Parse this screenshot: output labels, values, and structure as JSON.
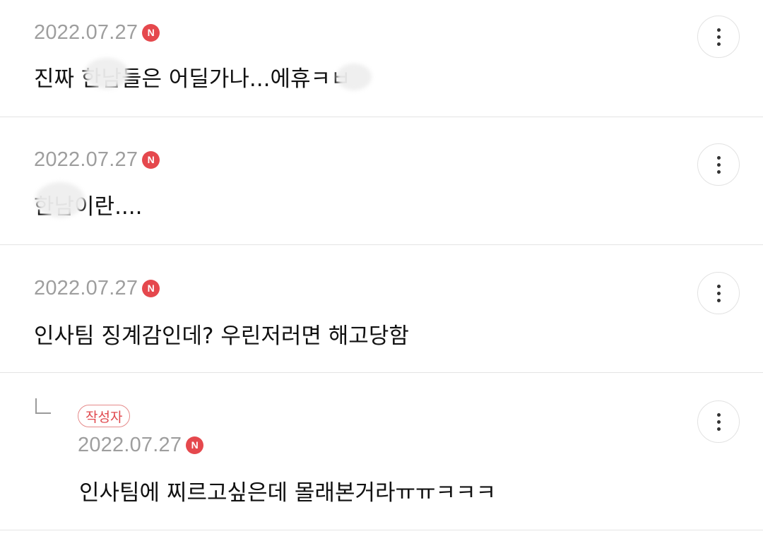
{
  "comments": [
    {
      "date": "2022.07.27",
      "new_badge": "N",
      "text": "진짜 한남들은 어딜가나...에휴ㅋㅂ"
    },
    {
      "date": "2022.07.27",
      "new_badge": "N",
      "text": "한남이란...."
    },
    {
      "date": "2022.07.27",
      "new_badge": "N",
      "text": "인사팀 징계감인데? 우린저러면 해고당함"
    },
    {
      "is_reply": true,
      "author_badge": "작성자",
      "date": "2022.07.27",
      "new_badge": "N",
      "text": "인사팀에 찌르고싶은데 몰래본거라ㅠㅠㅋㅋㅋ"
    }
  ],
  "icons": {
    "more": "more-vertical-icon",
    "new": "new-badge-icon",
    "reply": "reply-arrow-icon"
  },
  "colors": {
    "new_badge": "#e5484d",
    "author_badge": "#e0484d",
    "date": "#9e9e9e",
    "text": "#111111"
  }
}
